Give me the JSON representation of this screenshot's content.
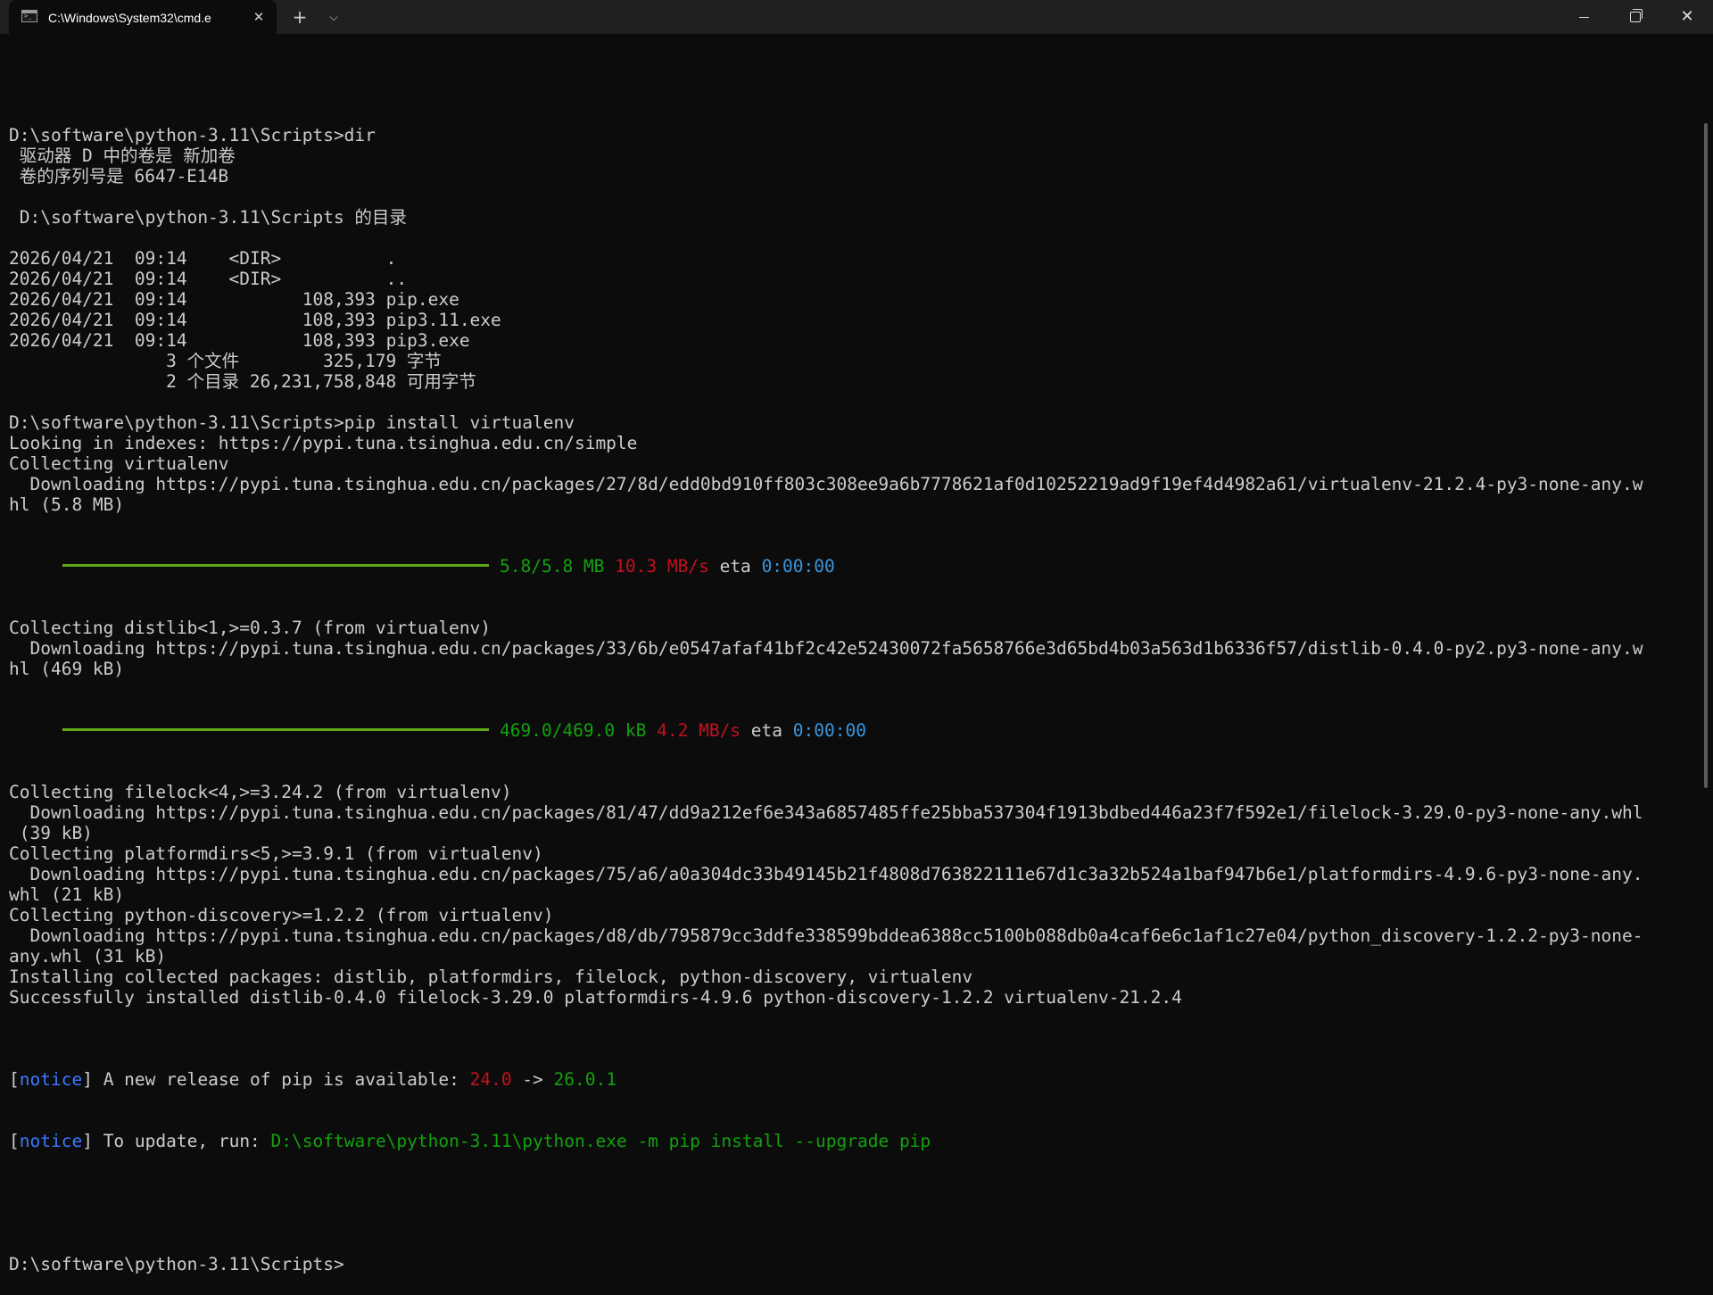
{
  "window": {
    "tab_title": "C:\\Windows\\System32\\cmd.e",
    "close_tab": "✕",
    "new_tab": "+",
    "dropdown": "⌄",
    "close_window": "✕"
  },
  "terminal": {
    "lines": [
      "",
      "D:\\software\\python-3.11\\Scripts>dir",
      " 驱动器 D 中的卷是 新加卷",
      " 卷的序列号是 6647-E14B",
      "",
      " D:\\software\\python-3.11\\Scripts 的目录",
      "",
      "2026/04/21  09:14    <DIR>          .",
      "2026/04/21  09:14    <DIR>          ..",
      "2026/04/21  09:14           108,393 pip.exe",
      "2026/04/21  09:14           108,393 pip3.11.exe",
      "2026/04/21  09:14           108,393 pip3.exe",
      "               3 个文件        325,179 字节",
      "               2 个目录 26,231,758,848 可用字节",
      "",
      "D:\\software\\python-3.11\\Scripts>pip install virtualenv",
      "Looking in indexes: https://pypi.tuna.tsinghua.edu.cn/simple",
      "Collecting virtualenv",
      "  Downloading https://pypi.tuna.tsinghua.edu.cn/packages/27/8d/edd0bd910ff803c308ee9a6b7778621af0d10252219ad9f19ef4d4982a61/virtualenv-21.2.4-py3-none-any.w",
      "hl (5.8 MB)"
    ],
    "progress1": {
      "size": "5.8/5.8 MB",
      "speed": "10.3 MB/s",
      "eta_label": "eta",
      "eta": "0:00:00",
      "fraction": 1.0
    },
    "lines2": [
      "Collecting distlib<1,>=0.3.7 (from virtualenv)",
      "  Downloading https://pypi.tuna.tsinghua.edu.cn/packages/33/6b/e0547afaf41bf2c42e52430072fa5658766e3d65bd4b03a563d1b6336f57/distlib-0.4.0-py2.py3-none-any.w",
      "hl (469 kB)"
    ],
    "progress2": {
      "size": "469.0/469.0 kB",
      "speed": "4.2 MB/s",
      "eta_label": "eta",
      "eta": "0:00:00",
      "fraction": 1.0
    },
    "lines3": [
      "Collecting filelock<4,>=3.24.2 (from virtualenv)",
      "  Downloading https://pypi.tuna.tsinghua.edu.cn/packages/81/47/dd9a212ef6e343a6857485ffe25bba537304f1913bdbed446a23f7f592e1/filelock-3.29.0-py3-none-any.whl",
      " (39 kB)",
      "Collecting platformdirs<5,>=3.9.1 (from virtualenv)",
      "  Downloading https://pypi.tuna.tsinghua.edu.cn/packages/75/a6/a0a304dc33b49145b21f4808d763822111e67d1c3a32b524a1baf947b6e1/platformdirs-4.9.6-py3-none-any.",
      "whl (21 kB)",
      "Collecting python-discovery>=1.2.2 (from virtualenv)",
      "  Downloading https://pypi.tuna.tsinghua.edu.cn/packages/d8/db/795879cc3ddfe338599bddea6388cc5100b088db0a4caf6e6c1af1c27e04/python_discovery-1.2.2-py3-none-",
      "any.whl (31 kB)",
      "Installing collected packages: distlib, platformdirs, filelock, python-discovery, virtualenv",
      "Successfully installed distlib-0.4.0 filelock-3.29.0 platformdirs-4.9.6 python-discovery-1.2.2 virtualenv-21.2.4",
      ""
    ],
    "notice1": {
      "open": "[",
      "tag": "notice",
      "close": "]",
      "text": " A new release of pip is available: ",
      "old": "24.0",
      "arrow": " -> ",
      "new": "26.0.1"
    },
    "notice2": {
      "open": "[",
      "tag": "notice",
      "close": "]",
      "text": " To update, run: ",
      "cmd": "D:\\software\\python-3.11\\python.exe -m pip install --upgrade pip"
    },
    "prompt": "D:\\software\\python-3.11\\Scripts>"
  },
  "colors": {
    "background": "#0c0c0c",
    "text": "#cccccc",
    "green": "#13a10e",
    "red": "#c50f1f",
    "blue": "#3b78ff",
    "cyan": "#3a96dd",
    "progress_bar": "#61a91a"
  }
}
